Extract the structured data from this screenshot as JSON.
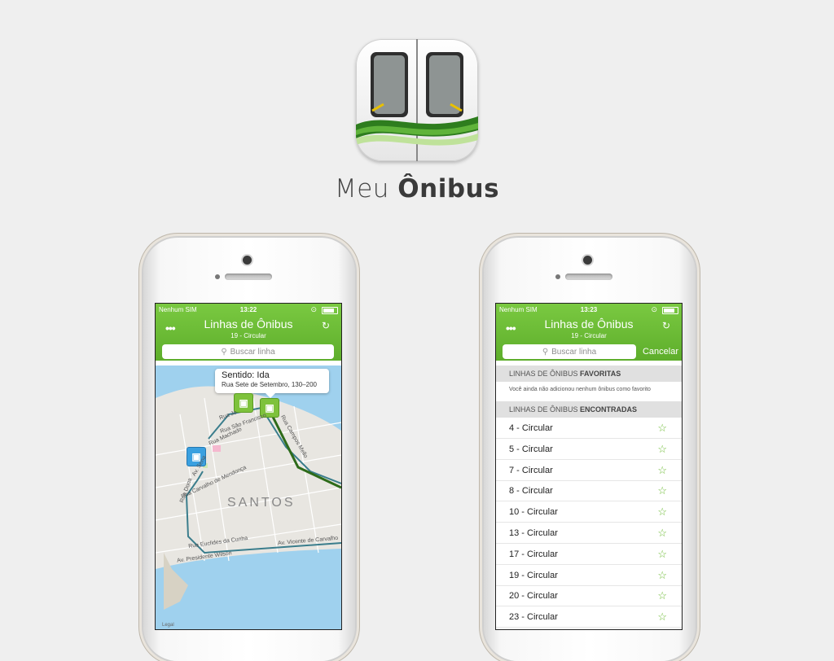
{
  "app": {
    "name_light": "Meu",
    "name_bold": "Ônibus",
    "icon": "bus-doors-icon",
    "accent_color": "#6cbb32"
  },
  "left_phone": {
    "status": {
      "carrier": "Nenhum SIM",
      "time": "13:22"
    },
    "header": {
      "title": "Linhas de Ônibus",
      "subtitle": "19 - Circular"
    },
    "search": {
      "placeholder": "Buscar linha"
    },
    "callout": {
      "title": "Sentido: Ida",
      "address": "Rua Sete de Setembro, 130–200"
    },
    "map": {
      "city": "SANTOS",
      "streets": [
        "Rua Jo",
        "Rua São Francisco",
        "Rua Machado",
        "Rua Campos Mello",
        "Rua Carvalho de Mendonça",
        "Rua Dona",
        "Rua Euclides da Cunha",
        "Av. Vicente de Carvalho",
        "Av. Presidente Wilson",
        "Av. Sena"
      ],
      "legal": "Legal"
    }
  },
  "right_phone": {
    "status": {
      "carrier": "Nenhum SIM",
      "time": "13:23"
    },
    "header": {
      "title": "Linhas de Ônibus",
      "subtitle": "19 - Circular"
    },
    "search": {
      "placeholder": "Buscar linha",
      "cancel": "Cancelar"
    },
    "favorites": {
      "heading_prefix": "LINHAS DE ÔNIBUS",
      "heading_bold": "FAVORITAS",
      "empty_message": "Você ainda não adicionou nenhum ônibus como favorito"
    },
    "found": {
      "heading_prefix": "LINHAS DE ÔNIBUS",
      "heading_bold": "ENCONTRADAS"
    },
    "lines": [
      "4 - Circular",
      "5 - Circular",
      "7 - Circular",
      "8 - Circular",
      "10 - Circular",
      "13 - Circular",
      "17 - Circular",
      "19 - Circular",
      "20 - Circular",
      "23 - Circular"
    ]
  }
}
